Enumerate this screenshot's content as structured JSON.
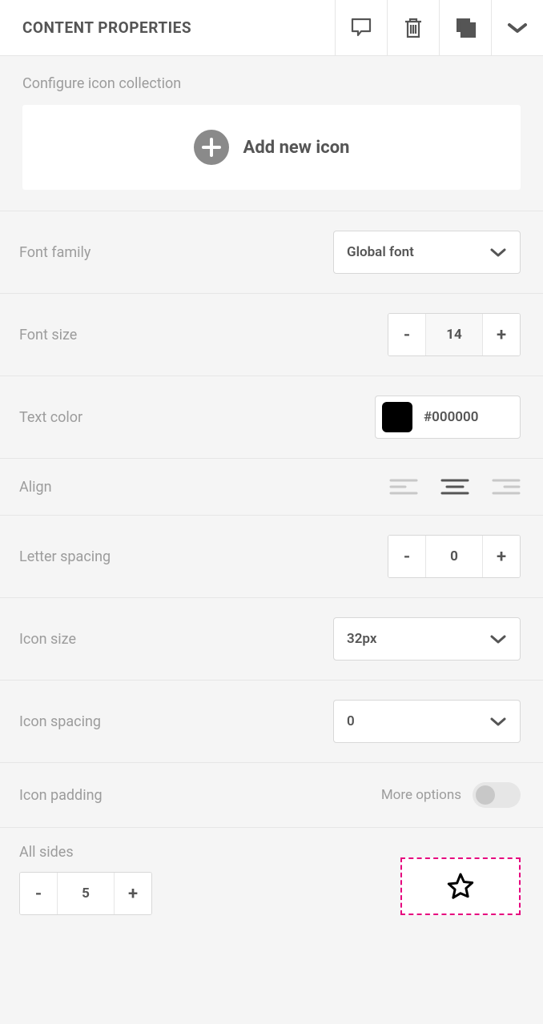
{
  "header": {
    "title": "CONTENT PROPERTIES"
  },
  "configure": {
    "label": "Configure icon collection",
    "add_label": "Add new icon"
  },
  "font_family": {
    "label": "Font family",
    "value": "Global font"
  },
  "font_size": {
    "label": "Font size",
    "value": "14"
  },
  "text_color": {
    "label": "Text color",
    "value": "#000000",
    "swatch": "#000000"
  },
  "align": {
    "label": "Align"
  },
  "letter_spacing": {
    "label": "Letter spacing",
    "value": "0"
  },
  "icon_size": {
    "label": "Icon size",
    "value": "32px"
  },
  "icon_spacing": {
    "label": "Icon spacing",
    "value": "0"
  },
  "icon_padding": {
    "label": "Icon padding",
    "more_options": "More options"
  },
  "all_sides": {
    "label": "All sides",
    "value": "5"
  }
}
